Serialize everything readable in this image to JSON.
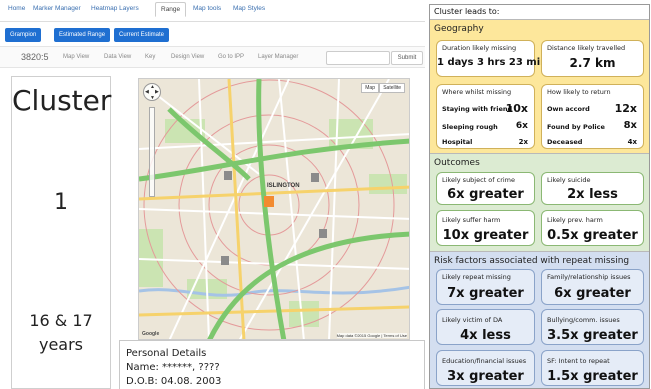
{
  "nav": {
    "tabs": [
      "Home",
      "Marker Manager",
      "Heatmap Layers",
      "Range",
      "Map tools",
      "Map Styles"
    ],
    "active_tab": "Range"
  },
  "pills": [
    "Grampion",
    "Estimated Range",
    "Current Estimate"
  ],
  "subnav": {
    "brand": "3820:5",
    "links": [
      "Map View",
      "Data View",
      "Key",
      "Design View",
      "Go to IPP",
      "Layer Manager"
    ],
    "search_placeholder": "",
    "submit_label": "Submit"
  },
  "left_card": {
    "title": "Cluster",
    "number": "1",
    "age": "16 & 17",
    "age_unit": "years"
  },
  "map": {
    "map_type_buttons": [
      "Map",
      "Satellite"
    ],
    "place_label": "ISLINGTON",
    "footer": "Map data ©2015 Google  |  Terms of Use",
    "google": "Google"
  },
  "personal": {
    "heading": "Personal Details",
    "name_line": "Name: ******, ????",
    "dob_line": "D.O.B: 04.08. 2003"
  },
  "panel": {
    "title": "Cluster leads to:",
    "geography": {
      "title": "Geography",
      "duration_label": "Duration likely missing",
      "duration_value": "1 days 3 hrs 23 mins",
      "distance_label": "Distance likely travelled",
      "distance_value": "2.7 km",
      "where_label": "Where whilst missing",
      "where_rows": [
        {
          "label": "Staying with friend",
          "value": "10x"
        },
        {
          "label": "Sleeping rough",
          "value": "6x"
        },
        {
          "label": "Hospital",
          "value": "2x"
        }
      ],
      "return_label": "How likely to return",
      "return_rows": [
        {
          "label": "Own accord",
          "value": "12x"
        },
        {
          "label": "Found by Police",
          "value": "8x"
        },
        {
          "label": "Deceased",
          "value": "4x"
        }
      ]
    },
    "outcomes": {
      "title": "Outcomes",
      "items": [
        {
          "label": "Likely subject of crime",
          "value": "6x greater"
        },
        {
          "label": "Likely suicide",
          "value": "2x less"
        },
        {
          "label": "Likely suffer harm",
          "value": "10x greater"
        },
        {
          "label": "Likely prev. harm",
          "value": "0.5x greater"
        }
      ]
    },
    "risk": {
      "title": "Risk factors associated with repeat missing",
      "items": [
        {
          "label": "Likely repeat missing",
          "value": "7x greater"
        },
        {
          "label": "Family/relationship issues",
          "value": "6x greater"
        },
        {
          "label": "Likely victim of DA",
          "value": "4x less"
        },
        {
          "label": "Bullying/comm. issues",
          "value": "3.5x greater"
        },
        {
          "label": "Education/financial issues",
          "value": "3x greater"
        },
        {
          "label": "SF: Intent to repeat",
          "value": "1.5x greater"
        }
      ]
    }
  },
  "colors": {
    "accent": "#1f6fd1",
    "geography_bg": "#fde79b",
    "outcomes_bg": "#dcebd2",
    "risk_bg": "#d3def0",
    "risk_box_bg": "#e5ecf7"
  }
}
